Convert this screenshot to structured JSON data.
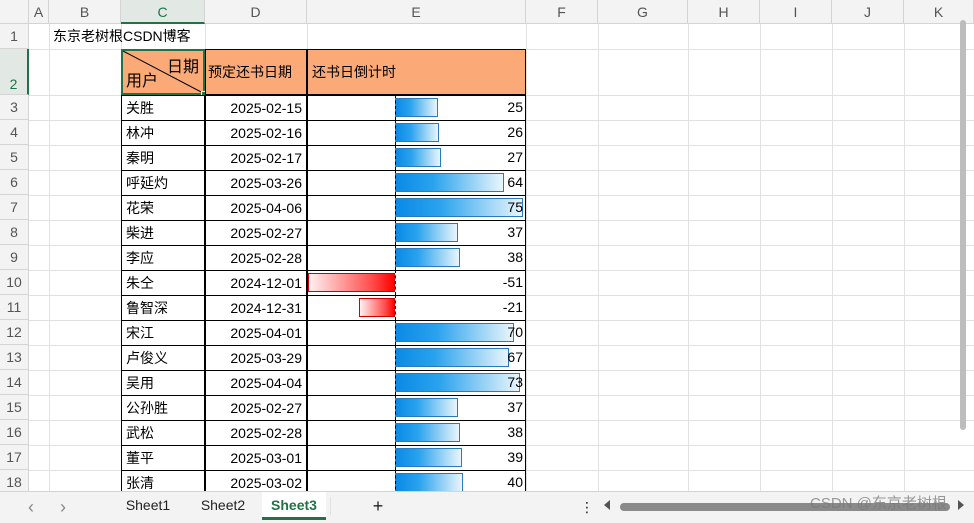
{
  "columns": [
    "A",
    "B",
    "C",
    "D",
    "E",
    "F",
    "G",
    "H",
    "I",
    "J",
    "K"
  ],
  "rows": [
    "1",
    "2",
    "3",
    "4",
    "5",
    "6",
    "7",
    "8",
    "9",
    "10",
    "11",
    "12",
    "13",
    "14",
    "15",
    "16",
    "17",
    "18"
  ],
  "title_cell": "东京老树根CSDN博客",
  "header": {
    "diag_top": "日期",
    "diag_bottom": "用户",
    "date_col": "预定还书日期",
    "countdown_col": "还书日倒计时"
  },
  "records": [
    {
      "name": "关胜",
      "date": "2025-02-15",
      "days": 25
    },
    {
      "name": "林冲",
      "date": "2025-02-16",
      "days": 26
    },
    {
      "name": "秦明",
      "date": "2025-02-17",
      "days": 27
    },
    {
      "name": "呼延灼",
      "date": "2025-03-26",
      "days": 64
    },
    {
      "name": "花荣",
      "date": "2025-04-06",
      "days": 75
    },
    {
      "name": "柴进",
      "date": "2025-02-27",
      "days": 37
    },
    {
      "name": "李应",
      "date": "2025-02-28",
      "days": 38
    },
    {
      "name": "朱仝",
      "date": "2024-12-01",
      "days": -51
    },
    {
      "name": "鲁智深",
      "date": "2024-12-31",
      "days": -21
    },
    {
      "name": "宋江",
      "date": "2025-04-01",
      "days": 70
    },
    {
      "name": "卢俊义",
      "date": "2025-03-29",
      "days": 67
    },
    {
      "name": "吴用",
      "date": "2025-04-04",
      "days": 73
    },
    {
      "name": "公孙胜",
      "date": "2025-02-27",
      "days": 37
    },
    {
      "name": "武松",
      "date": "2025-02-28",
      "days": 38
    },
    {
      "name": "董平",
      "date": "2025-03-01",
      "days": 39
    },
    {
      "name": "张清",
      "date": "2025-03-02",
      "days": 40
    }
  ],
  "sheets": [
    "Sheet1",
    "Sheet2",
    "Sheet3"
  ],
  "active_sheet": "Sheet3",
  "nav": {
    "prev": "‹",
    "next": "›",
    "add": "+",
    "more": "⋮"
  },
  "watermark": "CSDN @东京老树根",
  "colors": {
    "positive_bar": "#0a8ae6",
    "negative_bar": "#ff0000",
    "header_fill": "#fba976",
    "selection": "#217346"
  }
}
